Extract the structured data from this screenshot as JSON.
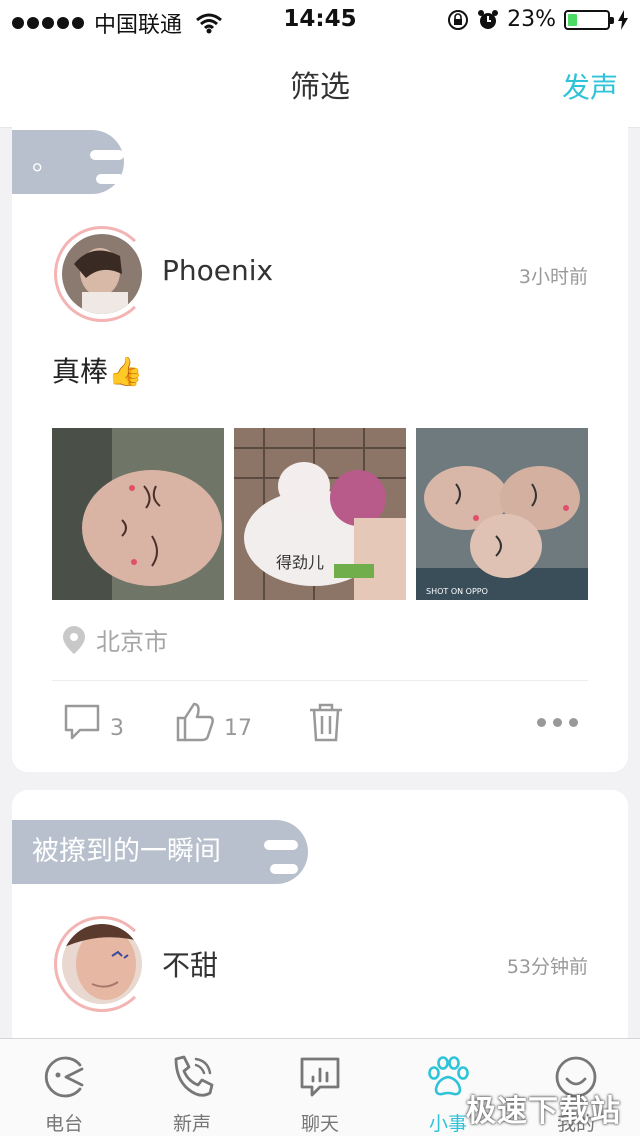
{
  "status_bar": {
    "carrier": "中国联通",
    "time": "14:45",
    "battery": "23%",
    "battery_level": 0.23
  },
  "nav": {
    "title": "筛选",
    "post_button": "发声",
    "accent_color": "#2fc3d8"
  },
  "feed": [
    {
      "topic": "。",
      "username": "Phoenix",
      "time": "3小时前",
      "text": "真棒👍",
      "photo_captions": [
        "",
        "得劲儿",
        "SHOT ON OPPO"
      ],
      "location": "北京市",
      "comments": "3",
      "likes": "17",
      "icons": [
        "comment-icon",
        "like-icon",
        "delete-icon",
        "more-icon"
      ]
    },
    {
      "topic": "被撩到的一瞬间",
      "username": "不甜",
      "time": "53分钟前"
    }
  ],
  "tabs": [
    {
      "label": "电台",
      "icon": "radio-icon"
    },
    {
      "label": "新声",
      "icon": "phone-icon"
    },
    {
      "label": "聊天",
      "icon": "chat-icon"
    },
    {
      "label": "小事",
      "icon": "paw-icon",
      "active": true
    },
    {
      "label": "我的",
      "icon": "smile-icon"
    }
  ],
  "watermark": "极速下载站"
}
